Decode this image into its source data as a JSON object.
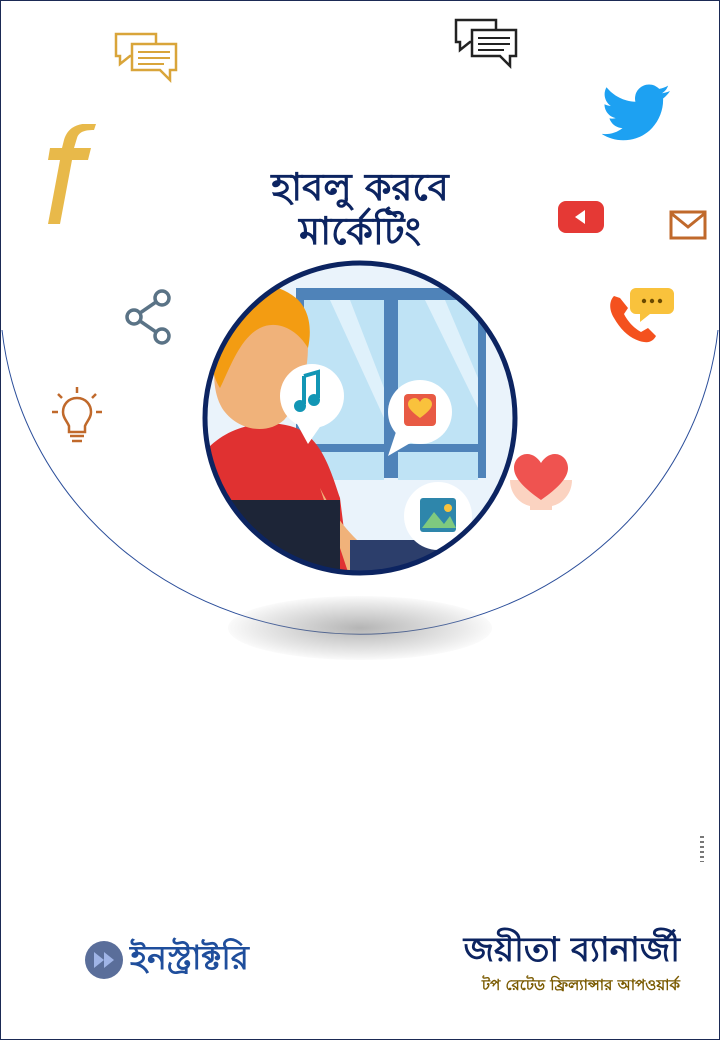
{
  "cover": {
    "title_line1": "হাবলু করবে",
    "title_line2": "মার্কেটিং"
  },
  "footer": {
    "brand": "ইনস্ট্রাক্টরি",
    "author_name": "জয়ীতা ব্যানার্জী",
    "author_subtitle": "টপ রেটেড ফ্রিল্যান্সার আপওয়ার্ক"
  },
  "colors": {
    "title": "#0c2461",
    "brand": "#1f4e9c",
    "subtitle": "#7a5a00",
    "facebook": "#e8b94a",
    "twitter": "#1da1f2",
    "youtube": "#e53935",
    "heart": "#ef5350"
  },
  "icons": [
    "facebook-icon",
    "chat-bubbles-icon",
    "twitter-icon",
    "youtube-icon",
    "mail-icon",
    "share-icon",
    "phone-chat-icon",
    "lightbulb-icon",
    "heart-hands-icon",
    "music-note-icon",
    "photo-icon"
  ]
}
